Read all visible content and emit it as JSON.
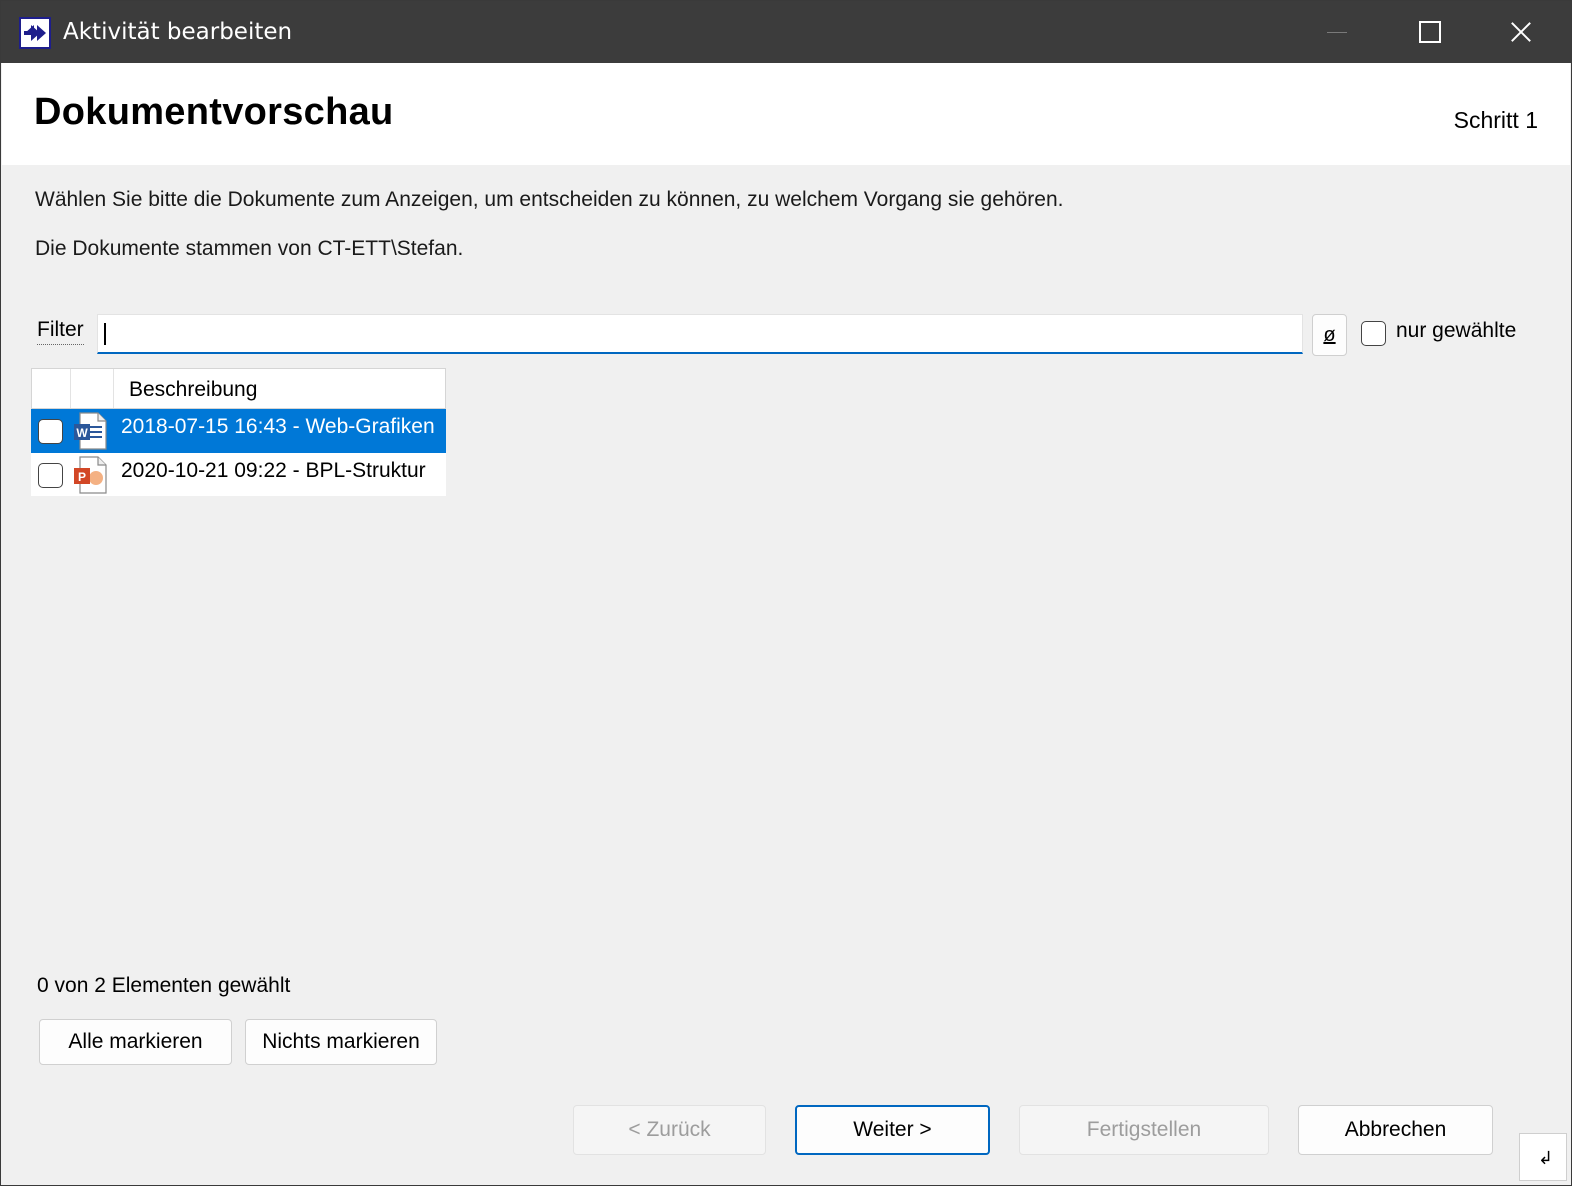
{
  "window": {
    "title": "Aktivität bearbeiten",
    "icon": "double-arrow-right-icon"
  },
  "header": {
    "title": "Dokumentvorschau",
    "step": "Schritt 1"
  },
  "description": {
    "line1": "Wählen Sie bitte die Dokumente zum Anzeigen, um entscheiden zu können, zu welchem Vorgang sie gehören.",
    "line2": "Die Dokumente stammen von CT-ETT\\Stefan."
  },
  "filter": {
    "label": "Filter",
    "value": "",
    "clear_label": "ø",
    "only_selected_label": "nur gewählte",
    "only_selected_checked": false
  },
  "list": {
    "column_header": "Beschreibung",
    "rows": [
      {
        "text": "2018-07-15 16:43 - Web-Grafiken",
        "icon": "word-document-icon",
        "checked": false,
        "selected": true
      },
      {
        "text": "2020-10-21 09:22 - BPL-Struktur",
        "icon": "powerpoint-document-icon",
        "checked": false,
        "selected": false
      }
    ]
  },
  "status": {
    "count_text": "0 von 2 Elementen gewählt"
  },
  "selection_buttons": {
    "select_all": "Alle markieren",
    "select_none": "Nichts markieren"
  },
  "nav_buttons": {
    "back": "< Zurück",
    "next": "Weiter >",
    "finish": "Fertigstellen",
    "cancel": "Abbrechen"
  },
  "colors": {
    "accent": "#0078d7",
    "titlebar": "#3c3c3c",
    "focus_border": "#0067c0"
  }
}
